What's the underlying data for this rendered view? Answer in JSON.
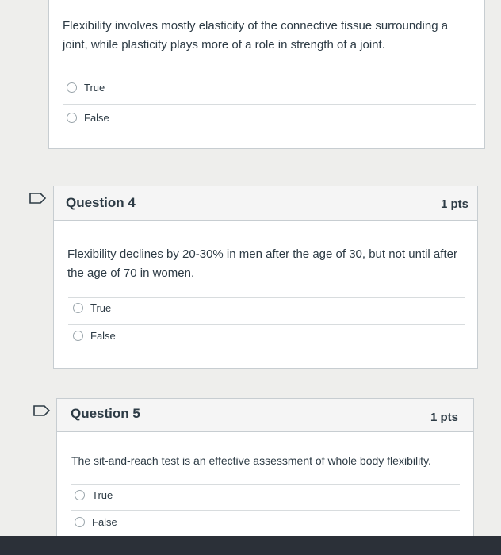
{
  "q3": {
    "prompt": "Flexibility involves mostly elasticity of the connective tissue surrounding a joint, while plasticity plays more of a role in strength of a joint.",
    "answers": [
      "True",
      "False"
    ]
  },
  "q4": {
    "title": "Question 4",
    "points": "1 pts",
    "prompt": "Flexibility declines by 20-30% in men after the age of 30, but not until after the age of 70 in women.",
    "answers": [
      "True",
      "False"
    ]
  },
  "q5": {
    "title": "Question 5",
    "points": "1 pts",
    "prompt": "The sit-and-reach test is an effective assessment of whole body flexibility.",
    "answers": [
      "True",
      "False"
    ]
  },
  "icons": {
    "flag": "flag-icon",
    "radio": "radio-button"
  },
  "colors": {
    "text": "#2d3b45",
    "border": "#c7cdd1",
    "header_bg": "#f5f5f5",
    "page_bg": "#eeeeec"
  }
}
